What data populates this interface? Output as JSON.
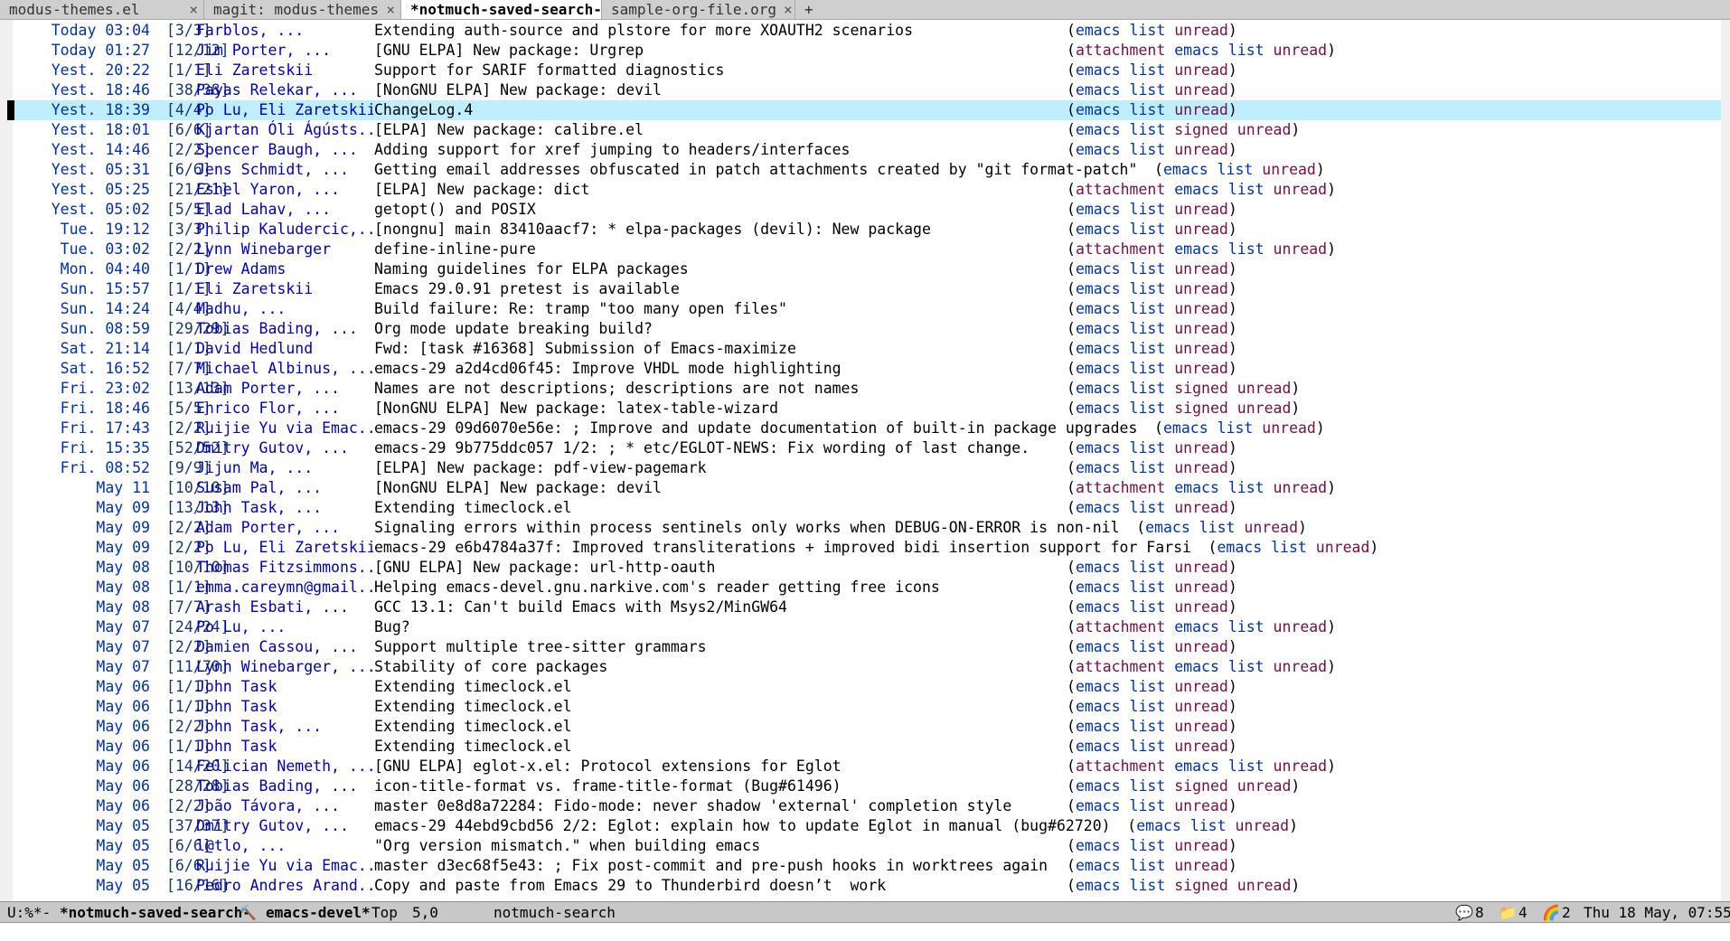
{
  "tabs": [
    {
      "label": "modus-themes.el",
      "current": false,
      "close": "×"
    },
    {
      "label": "magit: modus-themes",
      "current": false,
      "close": "×"
    },
    {
      "label": "*notmuch-saved-search-*",
      "current": true,
      "close": "×"
    },
    {
      "label": "sample-org-file.org",
      "current": false,
      "close": "×"
    }
  ],
  "new_tab_label": "+",
  "colors": {
    "date": "#0031a9",
    "authors": "#0000b0",
    "tag_list": "#0031a9",
    "tag_unread": "#721045",
    "highlight": "#bfefff"
  },
  "threads": [
    {
      "date": "Today 03:04",
      "count": "[3/3]",
      "authors": "Farblos, ...",
      "subject": "Extending auth-source and plstore for more XOAUTH2 scenarios",
      "tags": [
        "emacs",
        "list",
        "unread"
      ]
    },
    {
      "date": "Today 01:27",
      "count": "[12/12]",
      "authors": "Jim Porter, ...",
      "subject": "[GNU ELPA] New package: Urgrep",
      "tags": [
        "attachment",
        "emacs",
        "list",
        "unread"
      ]
    },
    {
      "date": "Yest. 20:22",
      "count": "[1/1]",
      "authors": "Eli Zaretskii",
      "subject": "Support for SARIF formatted diagnostics",
      "tags": [
        "emacs",
        "list",
        "unread"
      ]
    },
    {
      "date": "Yest. 18:46",
      "count": "[38/38]",
      "authors": "Payas Relekar, ...",
      "subject": "[NonGNU ELPA] New package: devil",
      "tags": [
        "emacs",
        "list",
        "unread"
      ]
    },
    {
      "date": "Yest. 18:39",
      "count": "[4/4]",
      "authors": "Po Lu, Eli Zaretskii",
      "subject": "ChangeLog.4",
      "tags": [
        "emacs",
        "list",
        "unread"
      ],
      "highlight": true
    },
    {
      "date": "Yest. 18:01",
      "count": "[6/6]",
      "authors": "Kjartan Óli Ágústs...",
      "subject": "[ELPA] New package: calibre.el",
      "tags": [
        "emacs",
        "list",
        "signed",
        "unread"
      ]
    },
    {
      "date": "Yest. 14:46",
      "count": "[2/2]",
      "authors": "Spencer Baugh, ...",
      "subject": "Adding support for xref jumping to headers/interfaces",
      "tags": [
        "emacs",
        "list",
        "unread"
      ]
    },
    {
      "date": "Yest. 05:31",
      "count": "[6/6]",
      "authors": "Jens Schmidt, ...",
      "subject": "Getting email addresses obfuscated in patch attachments created by \"git format-patch\"",
      "tags": [
        "emacs",
        "list",
        "unread"
      ]
    },
    {
      "date": "Yest. 05:25",
      "count": "[21/21]",
      "authors": "Eshel Yaron, ...",
      "subject": "[ELPA] New package: dict",
      "tags": [
        "attachment",
        "emacs",
        "list",
        "unread"
      ]
    },
    {
      "date": "Yest. 05:02",
      "count": "[5/5]",
      "authors": "Elad Lahav, ...",
      "subject": "getopt() and POSIX",
      "tags": [
        "emacs",
        "list",
        "unread"
      ]
    },
    {
      "date": "Tue. 19:12",
      "count": "[3/3]",
      "authors": "Philip Kaludercic,...",
      "subject": "[nongnu] main 83410aacf7: * elpa-packages (devil): New package",
      "tags": [
        "emacs",
        "list",
        "unread"
      ]
    },
    {
      "date": "Tue. 03:02",
      "count": "[2/2]",
      "authors": "Lynn Winebarger",
      "subject": "define-inline-pure",
      "tags": [
        "attachment",
        "emacs",
        "list",
        "unread"
      ]
    },
    {
      "date": "Mon. 04:40",
      "count": "[1/1]",
      "authors": "Drew Adams",
      "subject": "Naming guidelines for ELPA packages",
      "tags": [
        "emacs",
        "list",
        "unread"
      ]
    },
    {
      "date": "Sun. 15:57",
      "count": "[1/1]",
      "authors": "Eli Zaretskii",
      "subject": "Emacs 29.0.91 pretest is available",
      "tags": [
        "emacs",
        "list",
        "unread"
      ]
    },
    {
      "date": "Sun. 14:24",
      "count": "[4/4]",
      "authors": "Madhu, ...",
      "subject": "Build failure: Re: tramp \"too many open files\"",
      "tags": [
        "emacs",
        "list",
        "unread"
      ]
    },
    {
      "date": "Sun. 08:59",
      "count": "[29/29]",
      "authors": "Tobias Bading, ...",
      "subject": "Org mode update breaking build?",
      "tags": [
        "emacs",
        "list",
        "unread"
      ]
    },
    {
      "date": "Sat. 21:14",
      "count": "[1/1]",
      "authors": "David Hedlund",
      "subject": "Fwd: [task #16368] Submission of Emacs-maximize",
      "tags": [
        "emacs",
        "list",
        "unread"
      ]
    },
    {
      "date": "Sat. 16:52",
      "count": "[7/7]",
      "authors": "Michael Albinus, ...",
      "subject": "emacs-29 a2d4cd06f45: Improve VHDL mode highlighting",
      "tags": [
        "emacs",
        "list",
        "unread"
      ]
    },
    {
      "date": "Fri. 23:02",
      "count": "[13/13]",
      "authors": "Adam Porter, ...",
      "subject": "Names are not descriptions; descriptions are not names",
      "tags": [
        "emacs",
        "list",
        "signed",
        "unread"
      ]
    },
    {
      "date": "Fri. 18:46",
      "count": "[5/5]",
      "authors": "Enrico Flor, ...",
      "subject": "[NonGNU ELPA] New package: latex-table-wizard",
      "tags": [
        "emacs",
        "list",
        "signed",
        "unread"
      ]
    },
    {
      "date": "Fri. 17:43",
      "count": "[2/2]",
      "authors": "Ruijie Yu via Emac...",
      "subject": "emacs-29 09d6070e56e: ; Improve and update documentation of built-in package upgrades",
      "tags": [
        "emacs",
        "list",
        "unread"
      ]
    },
    {
      "date": "Fri. 15:35",
      "count": "[52/52]",
      "authors": "Dmitry Gutov, ...",
      "subject": "emacs-29 9b775ddc057 1/2: ; * etc/EGLOT-NEWS: Fix wording of last change.",
      "tags": [
        "emacs",
        "list",
        "unread"
      ]
    },
    {
      "date": "Fri. 08:52",
      "count": "[9/9]",
      "authors": "Jijun Ma, ...",
      "subject": "[ELPA] New package: pdf-view-pagemark",
      "tags": [
        "emacs",
        "list",
        "unread"
      ]
    },
    {
      "date": "May 11",
      "count": "[10/10]",
      "authors": "Susam Pal, ...",
      "subject": "[NonGNU ELPA] New package: devil",
      "tags": [
        "attachment",
        "emacs",
        "list",
        "unread"
      ]
    },
    {
      "date": "May 09",
      "count": "[13/13]",
      "authors": "John Task, ...",
      "subject": "Extending timeclock.el",
      "tags": [
        "emacs",
        "list",
        "unread"
      ]
    },
    {
      "date": "May 09",
      "count": "[2/2]",
      "authors": "Adam Porter, ...",
      "subject": "Signaling errors within process sentinels only works when DEBUG-ON-ERROR is non-nil",
      "tags": [
        "emacs",
        "list",
        "unread"
      ]
    },
    {
      "date": "May 09",
      "count": "[2/2]",
      "authors": "Po Lu, Eli Zaretskii",
      "subject": "emacs-29 e6b4784a37f: Improved transliterations + improved bidi insertion support for Farsi",
      "tags": [
        "emacs",
        "list",
        "unread"
      ]
    },
    {
      "date": "May 08",
      "count": "[10/10]",
      "authors": "Thomas Fitzsimmons...",
      "subject": "[GNU ELPA] New package: url-http-oauth",
      "tags": [
        "emacs",
        "list",
        "unread"
      ]
    },
    {
      "date": "May 08",
      "count": "[1/1]",
      "authors": "emma.careymn@gmail...",
      "subject": "Helping emacs-devel.gnu.narkive.com's reader getting free icons",
      "tags": [
        "emacs",
        "list",
        "unread"
      ]
    },
    {
      "date": "May 08",
      "count": "[7/7]",
      "authors": "Arash Esbati, ...",
      "subject": "GCC 13.1: Can't build Emacs with Msys2/MinGW64",
      "tags": [
        "emacs",
        "list",
        "unread"
      ]
    },
    {
      "date": "May 07",
      "count": "[24/24]",
      "authors": "Po Lu, ...",
      "subject": "Bug?",
      "tags": [
        "attachment",
        "emacs",
        "list",
        "unread"
      ]
    },
    {
      "date": "May 07",
      "count": "[2/2]",
      "authors": "Damien Cassou, ...",
      "subject": "Support multiple tree-sitter grammars",
      "tags": [
        "emacs",
        "list",
        "unread"
      ]
    },
    {
      "date": "May 07",
      "count": "[11/70]",
      "authors": "Lynn Winebarger, ...",
      "subject": "Stability of core packages",
      "tags": [
        "attachment",
        "emacs",
        "list",
        "unread"
      ]
    },
    {
      "date": "May 06",
      "count": "[1/1]",
      "authors": "John Task",
      "subject": "Extending timeclock.el",
      "tags": [
        "emacs",
        "list",
        "unread"
      ]
    },
    {
      "date": "May 06",
      "count": "[1/1]",
      "authors": "John Task",
      "subject": "Extending timeclock.el",
      "tags": [
        "emacs",
        "list",
        "unread"
      ]
    },
    {
      "date": "May 06",
      "count": "[2/2]",
      "authors": "John Task, ...",
      "subject": "Extending timeclock.el",
      "tags": [
        "emacs",
        "list",
        "unread"
      ]
    },
    {
      "date": "May 06",
      "count": "[1/1]",
      "authors": "John Task",
      "subject": "Extending timeclock.el",
      "tags": [
        "emacs",
        "list",
        "unread"
      ]
    },
    {
      "date": "May 06",
      "count": "[14/20]",
      "authors": "Felician Nemeth, ...",
      "subject": "[GNU ELPA] eglot-x.el: Protocol extensions for Eglot",
      "tags": [
        "attachment",
        "emacs",
        "list",
        "unread"
      ]
    },
    {
      "date": "May 06",
      "count": "[28/28]",
      "authors": "Tobias Bading, ...",
      "subject": "icon-title-format vs. frame-title-format (Bug#61496)",
      "tags": [
        "emacs",
        "list",
        "signed",
        "unread"
      ]
    },
    {
      "date": "May 06",
      "count": "[2/2]",
      "authors": "João Távora, ...",
      "subject": "master 0e8d8a72284: Fido-mode: never shadow 'external' completion style",
      "tags": [
        "emacs",
        "list",
        "unread"
      ]
    },
    {
      "date": "May 05",
      "count": "[37/37]",
      "authors": "Dmitry Gutov, ...",
      "subject": "emacs-29 44ebd9cbd56 2/2: Eglot: explain how to update Eglot in manual (bug#62720)",
      "tags": [
        "emacs",
        "list",
        "unread"
      ]
    },
    {
      "date": "May 05",
      "count": "[6/6]",
      "authors": "l@tlo, ...",
      "subject": "\"Org version mismatch.\" when building emacs",
      "tags": [
        "emacs",
        "list",
        "unread"
      ]
    },
    {
      "date": "May 05",
      "count": "[6/6]",
      "authors": "Ruijie Yu via Emac...",
      "subject": "master d3ec68f5e43: ; Fix post-commit and pre-push hooks in worktrees again",
      "tags": [
        "emacs",
        "list",
        "unread"
      ]
    },
    {
      "date": "May 05",
      "count": "[16/16]",
      "authors": "Pedro Andres Arand...",
      "subject": "Copy and paste from Emacs 29 to Thunderbird doesn’t  work",
      "tags": [
        "emacs",
        "list",
        "signed",
        "unread"
      ]
    }
  ],
  "modeline": {
    "state": "U:%*-",
    "buffer": "*notmuch-saved-search-",
    "hammer": "🔨",
    "query": "emacs-devel*",
    "position": "Top",
    "line_col": "5,0",
    "mode": "notmuch-search",
    "chat_icon": "💬",
    "chat_count": "8",
    "folder_icon": "📁",
    "folder_count": "4",
    "rainbow_icon": "🌈",
    "rainbow_count": "2",
    "datetime": "Thu 18 May, 07:55"
  }
}
